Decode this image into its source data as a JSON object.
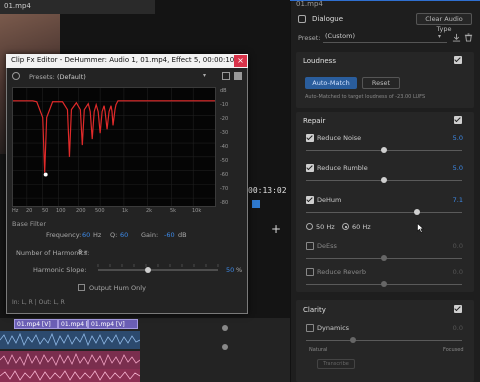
{
  "video": {
    "tab_title": "01.mp4",
    "timecode": "00:13:02",
    "timeline_add": "+",
    "clips": [
      {
        "label": "01.mp4 [V]"
      },
      {
        "label": "01.mp4 [V]"
      },
      {
        "label": "01.mp4 [V]"
      }
    ]
  },
  "essential_sound": {
    "tab_title": "01.mp4",
    "type_label": "Dialogue",
    "clear_button": "Clear Audio Type",
    "preset_label": "Preset:",
    "preset_value": "(Custom)",
    "loudness": {
      "title": "Loudness",
      "auto_match": "Auto-Match",
      "reset": "Reset",
      "note": "Auto-Matched to target loudness of -23.00 LUFS"
    },
    "repair": {
      "title": "Repair",
      "rows": [
        {
          "label": "Reduce Noise",
          "value": "5.0",
          "enabled": true,
          "level": 0.5
        },
        {
          "label": "Reduce Rumble",
          "value": "5.0",
          "enabled": true,
          "level": 0.5
        },
        {
          "label": "DeHum",
          "value": "7.1",
          "enabled": true,
          "level": 0.71
        },
        {
          "label": "DeEss",
          "value": "0.0",
          "enabled": false,
          "level": 0.5
        },
        {
          "label": "Reduce Reverb",
          "value": "0.0",
          "enabled": false,
          "level": 0.5
        }
      ],
      "hz_options": [
        "50 Hz",
        "60 Hz"
      ],
      "hz_selected": "60 Hz"
    },
    "clarity": {
      "title": "Clarity",
      "dynamics_label": "Dynamics",
      "dynamics_value": "0.0",
      "natural": "Natural",
      "focused": "Focused",
      "transcribe": "Transcribe"
    }
  },
  "fx_editor": {
    "title": "Clip Fx Editor - DeHummer: Audio 1, 01.mp4, Effect 5, 00:00:10:18",
    "close": "×",
    "presets_label": "Presets:",
    "preset_value": "(Default)",
    "db_labels": [
      "dB",
      "-10",
      "-20",
      "-30",
      "-40",
      "-50",
      "-60",
      "-70",
      "-80"
    ],
    "hz_labels": [
      "Hz",
      "20",
      "50",
      "100",
      "200",
      "500",
      "1k",
      "2k",
      "5k",
      "10k"
    ],
    "section_title": "Base Filter",
    "frequency_label": "Frequency:",
    "frequency_value": "60",
    "frequency_unit": "Hz",
    "q_label": "Q:",
    "q_value": "60",
    "gain_label": "Gain:",
    "gain_value": "-60",
    "gain_unit": "dB",
    "harmonics_label": "Number of Harmonics:",
    "harmonics_value": "8",
    "slope_label": "Harmonic Slope:",
    "slope_value": "50",
    "slope_unit": "%",
    "output_hum_label": "Output Hum Only",
    "io_label": "In: L, R | Out: L, R"
  },
  "colors": {
    "accent": "#3d8ae8",
    "filter_curve": "#e02a2a",
    "close_button": "#d9334a"
  }
}
